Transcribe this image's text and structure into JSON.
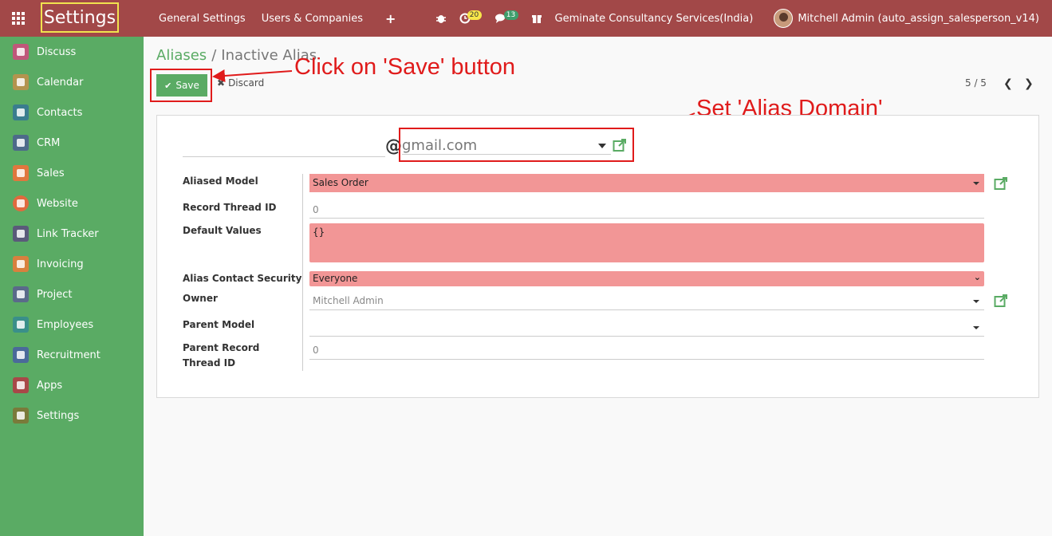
{
  "navbar": {
    "brand": "Settings",
    "menu": [
      "General Settings",
      "Users & Companies"
    ],
    "plus": "+",
    "activity_count": "20",
    "message_count": "13",
    "company": "Geminate Consultancy Services(India)",
    "user": "Mitchell Admin (auto_assign_salesperson_v14)"
  },
  "sidebar": {
    "items": [
      {
        "label": "Discuss",
        "color": "#c0577a"
      },
      {
        "label": "Calendar",
        "color": "#b3944e"
      },
      {
        "label": "Contacts",
        "color": "#3a7d8f"
      },
      {
        "label": "CRM",
        "color": "#4d6a8a"
      },
      {
        "label": "Sales",
        "color": "#e0773e"
      },
      {
        "label": "Website",
        "color": "#e06a3e"
      },
      {
        "label": "Link Tracker",
        "color": "#5a5a7a"
      },
      {
        "label": "Invoicing",
        "color": "#d8803e"
      },
      {
        "label": "Project",
        "color": "#5a6a8a"
      },
      {
        "label": "Employees",
        "color": "#3a8f8a"
      },
      {
        "label": "Recruitment",
        "color": "#4a6a9a"
      },
      {
        "label": "Apps",
        "color": "#a84848"
      },
      {
        "label": "Settings",
        "color": "#7a7a3a"
      }
    ]
  },
  "breadcrumb": {
    "parent": "Aliases",
    "separator": "/",
    "current": "Inactive Alias"
  },
  "buttons": {
    "save": "Save",
    "discard": "Discard"
  },
  "pager": {
    "value": "5 / 5"
  },
  "annotations": {
    "save": "Click on 'Save' button",
    "domain": "Set 'Alias Domain'"
  },
  "form": {
    "alias_name": "",
    "at_sign": "@",
    "alias_domain": "gmail.com",
    "fields": {
      "aliased_model": {
        "label": "Aliased Model",
        "value": "Sales Order"
      },
      "record_thread_id": {
        "label": "Record Thread ID",
        "value": "0"
      },
      "default_values": {
        "label": "Default Values",
        "value": "{}"
      },
      "alias_contact_security": {
        "label": "Alias Contact Security",
        "value": "Everyone"
      },
      "owner": {
        "label": "Owner",
        "value": "Mitchell Admin"
      },
      "parent_model": {
        "label": "Parent Model",
        "value": ""
      },
      "parent_record_thread_id": {
        "label": "Parent Record Thread ID",
        "value": "0"
      }
    }
  },
  "colors": {
    "navbar": "#a24848",
    "sidebar": "#5aab64",
    "required_field": "#f29696",
    "annotation": "#e01b1b"
  }
}
